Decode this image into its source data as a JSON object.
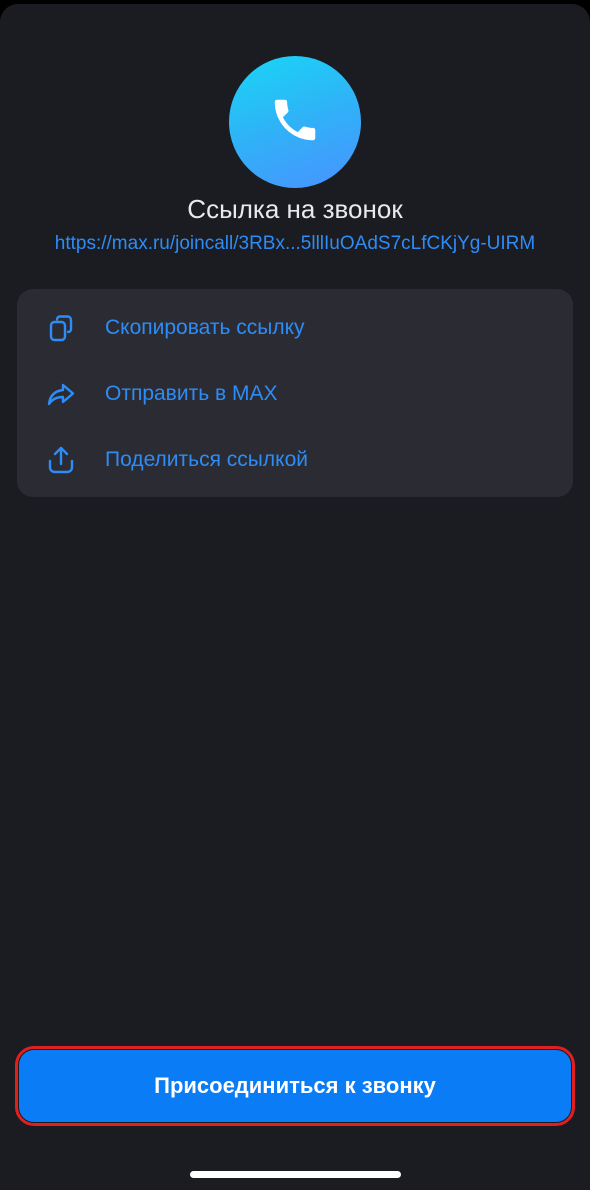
{
  "header": {
    "avatar_icon": "phone-icon",
    "title": "Ссылка на звонок",
    "link": "https://max.ru/joincall/3RBx...5lllIuOAdS7cLfCKjYg-UIRM"
  },
  "actions": [
    {
      "icon": "copy-icon",
      "label": "Скопировать ссылку"
    },
    {
      "icon": "forward-icon",
      "label": "Отправить в MAX"
    },
    {
      "icon": "share-icon",
      "label": "Поделиться ссылкой"
    }
  ],
  "join_button": {
    "label": "Присоединиться к звонку"
  },
  "colors": {
    "background": "#1b1c21",
    "card": "#2b2c33",
    "accent": "#2d8cf6",
    "button": "#0a7cf6",
    "highlight": "#e21f1f"
  }
}
